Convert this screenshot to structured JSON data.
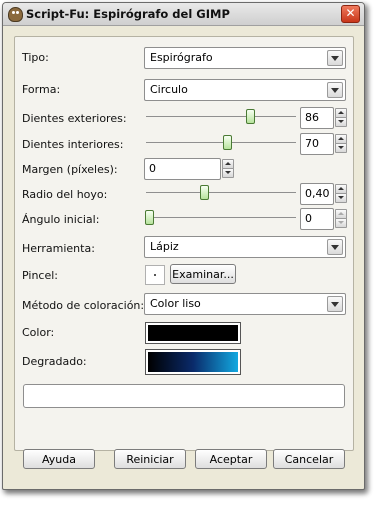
{
  "window": {
    "title": "Script-Fu: Espirógrafo del GIMP",
    "close_label": "✕"
  },
  "form": {
    "tipo": {
      "label": "Tipo:",
      "value": "Espirógrafo"
    },
    "forma": {
      "label": "Forma:",
      "value": "Circulo"
    },
    "dientes_exteriores": {
      "label": "Dientes exteriores:",
      "value": "86",
      "level": 0.58
    },
    "dientes_interiores": {
      "label": "Dientes interiores:",
      "value": "70",
      "level": 0.55
    },
    "margen": {
      "label": "Margen (píxeles):",
      "value": "0"
    },
    "radio_hoyo": {
      "label": "Radio del hoyo:",
      "value": "0,40",
      "level": 0.4
    },
    "angulo_inicial": {
      "label": "Ángulo inicial:",
      "value": "0",
      "level": 0.0
    },
    "herramienta": {
      "label": "Herramienta:",
      "value": "Lápiz"
    },
    "pincel": {
      "label": "Pincel:",
      "browse_label": "Examinar..."
    },
    "metodo_coloracion": {
      "label": "Método de coloración:",
      "value": "Color liso"
    },
    "color": {
      "label": "Color:",
      "value": "#000000"
    },
    "degradado": {
      "label": "Degradado:",
      "stops": [
        "#000000",
        "#0a2a6a",
        "#12a8e0"
      ]
    },
    "output_text": ""
  },
  "buttons": {
    "ayuda": "Ayuda",
    "reiniciar": "Reiniciar",
    "aceptar": "Aceptar",
    "cancelar": "Cancelar"
  }
}
